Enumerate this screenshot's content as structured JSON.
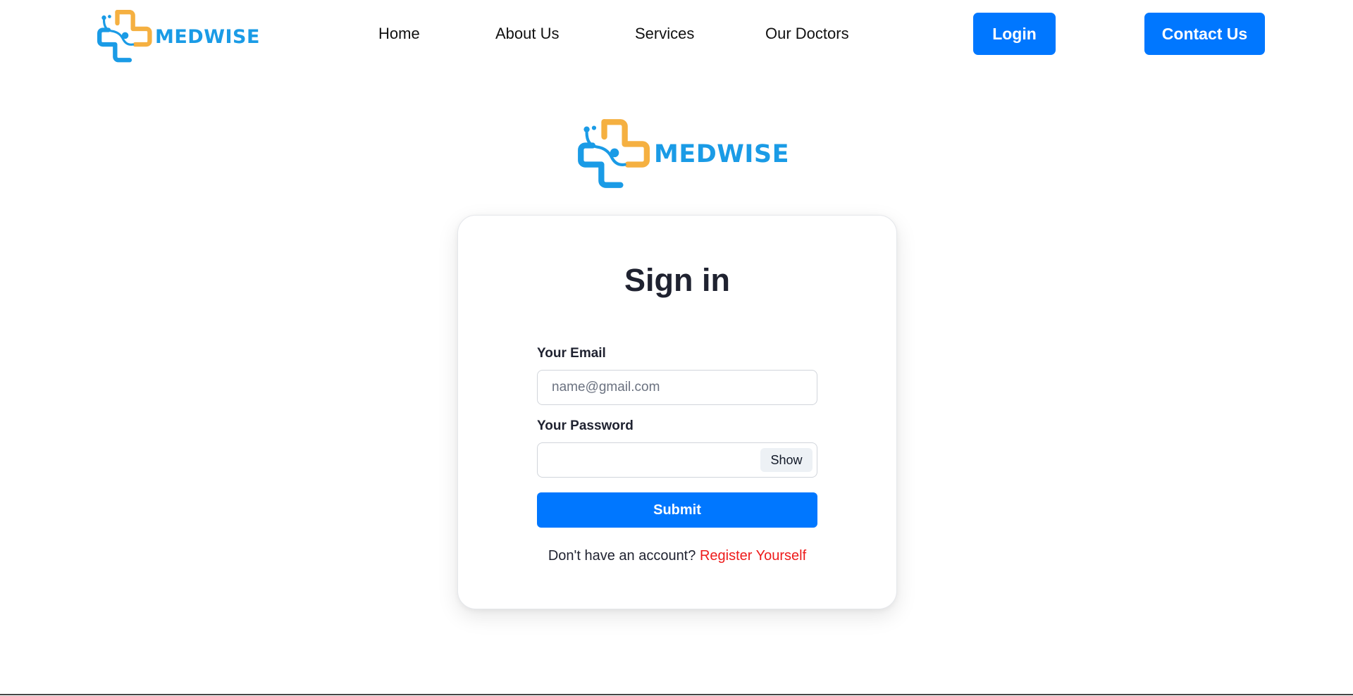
{
  "brand": {
    "name": "MEDWISE",
    "colors": {
      "blue": "#1a9be6",
      "orange": "#f5b041"
    },
    "icon": "medical-cross-stethoscope-icon"
  },
  "nav": {
    "links": [
      {
        "label": "Home"
      },
      {
        "label": "About Us"
      },
      {
        "label": "Services"
      },
      {
        "label": "Our Doctors"
      }
    ],
    "login_label": "Login",
    "contact_label": "Contact Us"
  },
  "signin": {
    "title": "Sign in",
    "email_label": "Your Email",
    "email_placeholder": "name@gmail.com",
    "email_value": "",
    "password_label": "Your Password",
    "password_value": "",
    "show_label": "Show",
    "submit_label": "Submit",
    "register_prompt": "Don't have an account?",
    "register_link": "Register Yourself"
  },
  "colors": {
    "accent": "#0077ff",
    "link_red": "#ee1b1b",
    "text_dark": "#1f2230"
  }
}
